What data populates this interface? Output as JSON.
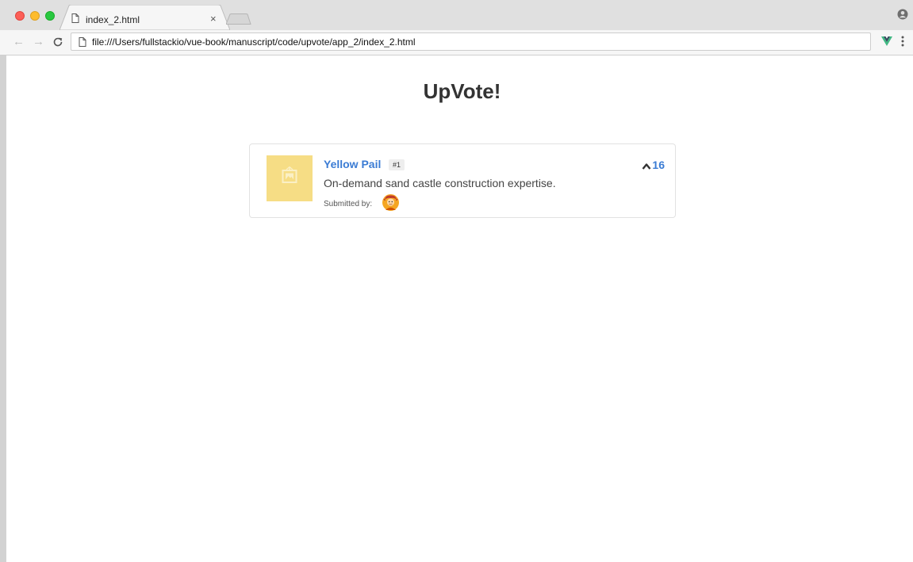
{
  "browser": {
    "tab_title": "index_2.html",
    "tab_close": "×",
    "url": "file:///Users/fullstackio/vue-book/manuscript/code/upvote/app_2/index_2.html",
    "back_glyph": "←",
    "forward_glyph": "→"
  },
  "page": {
    "title": "UpVote!"
  },
  "products": [
    {
      "title": "Yellow Pail",
      "rank": "#1",
      "description": "On-demand sand castle construction expertise.",
      "submitted_label": "Submitted by:",
      "votes": "16",
      "thumbnail_color": "#f6dd85",
      "thumbnail_icon": "image-placeholder-icon",
      "avatar_icon": "user-avatar"
    }
  ],
  "colors": {
    "link": "#3b7cd4",
    "title": "#333333"
  }
}
